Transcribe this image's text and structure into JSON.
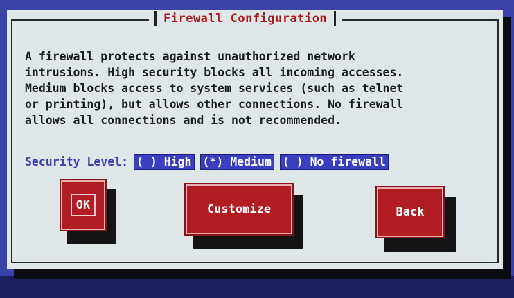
{
  "dialog": {
    "title": "Firewall Configuration",
    "description": "A firewall protects against unauthorized network\nintrusions. High security blocks all incoming accesses.\nMedium blocks access to system services (such as telnet\nor printing), but allows other connections. No firewall\nallows all connections and is not recommended."
  },
  "security": {
    "label": "Security Level:",
    "options": [
      {
        "label": "( ) High",
        "selected": false
      },
      {
        "label": "(*) Medium",
        "selected": true
      },
      {
        "label": "( ) No firewall",
        "selected": false
      }
    ]
  },
  "buttons": {
    "ok": "OK",
    "customize": "Customize",
    "back": "Back"
  },
  "colors": {
    "screen_bg": "#3a44a8",
    "dialog_bg": "#dfe6e8",
    "title": "#a81818",
    "button": "#b21d24",
    "radio_bg": "#3a3fbf"
  }
}
